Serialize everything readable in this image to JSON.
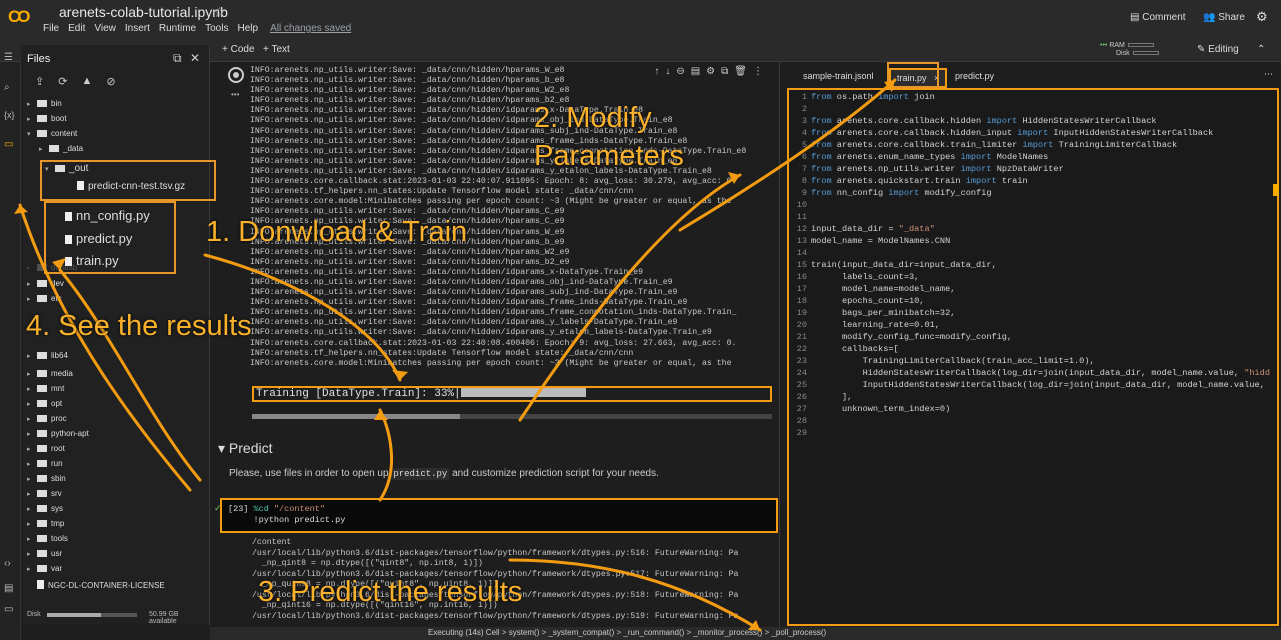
{
  "header": {
    "logo": "CO",
    "notebook_name": "arenets-colab-tutorial.ipynb",
    "star": "☆",
    "menu": [
      "File",
      "Edit",
      "View",
      "Insert",
      "Runtime",
      "Tools",
      "Help"
    ],
    "save_status": "All changes saved",
    "comment": "Comment",
    "share": "Share",
    "gear": "⚙"
  },
  "toolbar": {
    "add_code": "+ Code",
    "add_text": "+ Text",
    "ram": "RAM",
    "disk": "Disk",
    "editing": "Editing"
  },
  "files": {
    "title": "Files",
    "tree": [
      {
        "label": "bin",
        "type": "folder",
        "caret": "▸"
      },
      {
        "label": "boot",
        "type": "folder",
        "caret": "▸"
      },
      {
        "label": "content",
        "type": "folder",
        "caret": "▾"
      },
      {
        "label": "_data",
        "type": "folder",
        "caret": "▸"
      },
      {
        "label": "_out",
        "type": "folder",
        "caret": "▾"
      },
      {
        "label": "predict-cnn-test.tsv.gz",
        "type": "file",
        "caret": ""
      },
      {
        "label": "nn_config.py",
        "type": "file",
        "caret": ""
      },
      {
        "label": "predict.py",
        "type": "file",
        "caret": ""
      },
      {
        "label": "train.py",
        "type": "file",
        "caret": ""
      },
      {
        "label": "datalab",
        "type": "folder",
        "caret": "▸"
      },
      {
        "label": "dev",
        "type": "folder",
        "caret": "▸"
      },
      {
        "label": "etc",
        "type": "folder",
        "caret": "▸"
      },
      {
        "label": "lib64",
        "type": "folder",
        "caret": "▸"
      },
      {
        "label": "media",
        "type": "folder",
        "caret": "▸"
      },
      {
        "label": "mnt",
        "type": "folder",
        "caret": "▸"
      },
      {
        "label": "opt",
        "type": "folder",
        "caret": "▸"
      },
      {
        "label": "proc",
        "type": "folder",
        "caret": "▸"
      },
      {
        "label": "python-apt",
        "type": "folder",
        "caret": "▸"
      },
      {
        "label": "root",
        "type": "folder",
        "caret": "▸"
      },
      {
        "label": "run",
        "type": "folder",
        "caret": "▸"
      },
      {
        "label": "sbin",
        "type": "folder",
        "caret": "▸"
      },
      {
        "label": "srv",
        "type": "folder",
        "caret": "▸"
      },
      {
        "label": "sys",
        "type": "folder",
        "caret": "▸"
      },
      {
        "label": "tmp",
        "type": "folder",
        "caret": "▸"
      },
      {
        "label": "tools",
        "type": "folder",
        "caret": "▸"
      },
      {
        "label": "usr",
        "type": "folder",
        "caret": "▸"
      },
      {
        "label": "var",
        "type": "folder",
        "caret": "▸"
      },
      {
        "label": "NGC-DL-CONTAINER-LICENSE",
        "type": "file",
        "caret": ""
      }
    ],
    "disk_label": "Disk",
    "disk_value": "50.99 GB available",
    "disk_used_fraction": 0.6
  },
  "notebook": {
    "output_lines": [
      "INFO:arenets.np_utils.writer:Save: _data/cnn/hidden/hparams_W_e8",
      "INFO:arenets.np_utils.writer:Save: _data/cnn/hidden/hparams_b_e8",
      "INFO:arenets.np_utils.writer:Save: _data/cnn/hidden/hparams_W2_e8",
      "INFO:arenets.np_utils.writer:Save: _data/cnn/hidden/hparams_b2_e8",
      "INFO:arenets.np_utils.writer:Save: _data/cnn/hidden/idparams_x-DataType.Train_e8",
      "INFO:arenets.np_utils.writer:Save: _data/cnn/hidden/idparams_obj_ind-DataType.Train_e8",
      "INFO:arenets.np_utils.writer:Save: _data/cnn/hidden/idparams_subj_ind-DataType.Train_e8",
      "INFO:arenets.np_utils.writer:Save: _data/cnn/hidden/idparams_frame_inds-DataType.Train_e8",
      "INFO:arenets.np_utils.writer:Save: _data/cnn/hidden/idparams_frame_connotation_inds-DataType.Train_e8",
      "INFO:arenets.np_utils.writer:Save: _data/cnn/hidden/idparams_y_labels-DataType.Train_e8",
      "INFO:arenets.np_utils.writer:Save: _data/cnn/hidden/idparams_y_etalon_labels-DataType.Train_e8",
      "INFO:arenets.core.callback.stat:2023-01-03 22:40:07.911095: Epoch: 8: avg_loss: 30.279, avg_acc: 0.",
      "INFO:arenets.tf_helpers.nn_states:Update Tensorflow model state: _data/cnn/cnn",
      "INFO:arenets.core.model:Minibatches passing per epoch count: ~3 (Might be greater or equal, as the",
      "INFO:arenets.np_utils.writer:Save: _data/cnn/hidden/hparams_C_e9",
      "INFO:arenets.np_utils.writer:Save: _data/cnn/hidden/hparams_C_e9",
      "INFO:arenets.np_utils.writer:Save: _data/cnn/hidden/hparams_W_e9",
      "INFO:arenets.np_utils.writer:Save: _data/cnn/hidden/hparams_b_e9",
      "INFO:arenets.np_utils.writer:Save: _data/cnn/hidden/hparams_W2_e9",
      "INFO:arenets.np_utils.writer:Save: _data/cnn/hidden/hparams_b2_e9",
      "INFO:arenets.np_utils.writer:Save: _data/cnn/hidden/idparams_x-DataType.Train_e9",
      "INFO:arenets.np_utils.writer:Save: _data/cnn/hidden/idparams_obj_ind-DataType.Train_e9",
      "INFO:arenets.np_utils.writer:Save: _data/cnn/hidden/idparams_subj_ind-DataType.Train_e9",
      "INFO:arenets.np_utils.writer:Save: _data/cnn/hidden/idparams_frame_inds-DataType.Train_e9",
      "INFO:arenets.np_utils.writer:Save: _data/cnn/hidden/idparams_frame_connotation_inds-DataType.Train_",
      "INFO:arenets.np_utils.writer:Save: _data/cnn/hidden/idparams_y_labels-DataType.Train_e9",
      "INFO:arenets.np_utils.writer:Save: _data/cnn/hidden/idparams_y_etalon_labels-DataType.Train_e9",
      "INFO:arenets.core.callback.stat:2023-01-03 22:40:08.400406: Epoch: 9: avg_loss: 27.663, avg_acc: 0.",
      "INFO:arenets.tf_helpers.nn_states:Update Tensorflow model state: _data/cnn/cnn",
      "INFO:arenets.core.model:Minibatches passing per epoch count: ~3 (Might be greater or equal, as the"
    ],
    "training_text": "Training [DataType.Train]:  33%|",
    "training_progress": 0.33,
    "predict_heading": "Predict",
    "predict_text_before": "Please, use files in order to open up ",
    "predict_code": "predict.py",
    "predict_text_after": " and customize prediction script for your needs.",
    "cell_exec": "[23]",
    "cell_line1_magic": "%cd",
    "cell_line1_arg": "\"/content\"",
    "cell_line2": "!python predict.py",
    "output2_lines": [
      "/content",
      "/usr/local/lib/python3.6/dist-packages/tensorflow/python/framework/dtypes.py:516: FutureWarning: Pa",
      "  _np_qint8 = np.dtype([(\"qint8\", np.int8, 1)])",
      "/usr/local/lib/python3.6/dist-packages/tensorflow/python/framework/dtypes.py:517: FutureWarning: Pa",
      "  _np_quint8 = np.dtype([(\"quint8\", np.uint8, 1)])",
      "/usr/local/lib/python3.6/dist-packages/tensorflow/python/framework/dtypes.py:518: FutureWarning: Pa",
      "  _np_qint16 = np.dtype([(\"qint16\", np.int16, 1)])",
      "/usr/local/lib/python3.6/dist-packages/tensorflow/python/framework/dtypes.py:519: FutureWarning: Pa"
    ]
  },
  "editor": {
    "tabs": [
      "sample-train.jsonl",
      "train.py",
      "predict.py"
    ],
    "active_tab_close": "×",
    "more": "⋯",
    "code_html": [
      "<span class=\"kw\">from</span> os.path <span class=\"kw\">import</span> join",
      "",
      "<span class=\"kw\">from</span> arenets.core.callback.hidden <span class=\"kw\">import</span> HiddenStatesWriterCallback",
      "<span class=\"kw\">from</span> arenets.core.callback.hidden_input <span class=\"kw\">import</span> InputHiddenStatesWriterCallback",
      "<span class=\"kw\">from</span> arenets.core.callback.train_limiter <span class=\"kw\">import</span> TrainingLimiterCallback",
      "<span class=\"kw\">from</span> arenets.enum_name_types <span class=\"kw\">import</span> ModelNames",
      "<span class=\"kw\">from</span> arenets.np_utils.writer <span class=\"kw\">import</span> NpzDataWriter",
      "<span class=\"kw\">from</span> arenets.quickstart.train <span class=\"kw\">import</span> train",
      "<span class=\"kw\">from</span> nn_config <span class=\"kw\">import</span> modify_config",
      "",
      "",
      "input_data_dir = <span class=\"str\">\"_data\"</span>",
      "model_name = ModelNames.CNN",
      "",
      "train(input_data_dir=input_data_dir,",
      "      labels_count=3,",
      "      model_name=model_name,",
      "      epochs_count=10,",
      "      bags_per_minibatch=32,",
      "      learning_rate=0.01,",
      "      modify_config_func=modify_config,",
      "      callbacks=[",
      "          TrainingLimiterCallback(train_acc_limit=1.0),",
      "          HiddenStatesWriterCallback(log_dir=join(input_data_dir, model_name.value, <span class=\"str\">\"hidd</span>",
      "          InputHiddenStatesWriterCallback(log_dir=join(input_data_dir, model_name.value,",
      "      ],",
      "      unknown_term_index=0)",
      "",
      ""
    ]
  },
  "status_bar": "Executing (14s)  Cell > system() > _system_compat() > _run_command() > _monitor_process() > _poll_process()",
  "annotations": {
    "step1": "1. Donwload & Train",
    "step2a": "2. Modify",
    "step2b": "Parameters",
    "step3": "3. Predict the results",
    "step4": "4. See the results"
  },
  "colors": {
    "accent": "#f39c12",
    "annotation": "#f9b12b",
    "brand": "#f9ab00"
  }
}
